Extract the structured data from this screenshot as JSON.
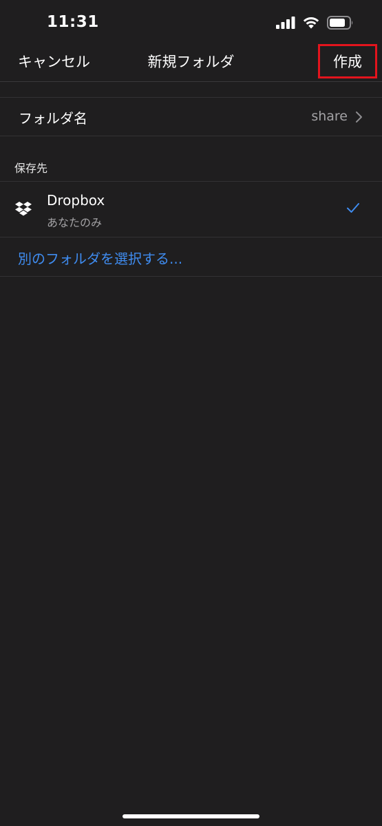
{
  "status_bar": {
    "time": "11:31",
    "icons": [
      "cellular-signal-icon",
      "wifi-icon",
      "battery-icon"
    ]
  },
  "nav": {
    "cancel_label": "キャンセル",
    "title": "新規フォルダ",
    "create_label": "作成",
    "highlight_color": "#e3141d"
  },
  "folder_name": {
    "label": "フォルダ名",
    "value": "share"
  },
  "save_location": {
    "header": "保存先",
    "selected": {
      "icon": "dropbox-icon",
      "title": "Dropbox",
      "subtitle": "あなたのみ",
      "checked": true
    },
    "choose_other_label": "別のフォルダを選択する..."
  },
  "colors": {
    "background": "#1f1e1f",
    "accent": "#3f8cf0",
    "secondary_text": "#a3a2a5"
  }
}
